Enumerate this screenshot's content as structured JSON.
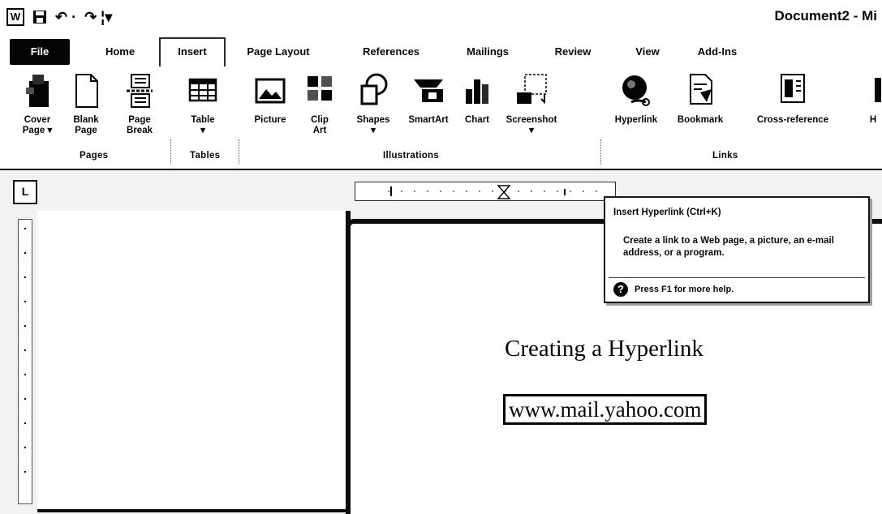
{
  "window": {
    "app_icon": "W",
    "title": "Document2 - Mi",
    "qat": {
      "save_icon": "save-icon",
      "undo_symbol": "↶ ·",
      "redo_symbol": "↷ ¦▾"
    }
  },
  "tabs": [
    {
      "label": "File"
    },
    {
      "label": "Home"
    },
    {
      "label": "Insert",
      "active": true
    },
    {
      "label": "Page Layout"
    },
    {
      "label": "References"
    },
    {
      "label": "Mailings"
    },
    {
      "label": "Review"
    },
    {
      "label": "View"
    },
    {
      "label": "Add-Ins"
    }
  ],
  "ribbon": {
    "pages": {
      "group_label": "Pages",
      "cover_page": "Cover Page ▾",
      "blank_page": "Blank Page",
      "page_break": "Page Break"
    },
    "tables": {
      "group_label": "Tables",
      "table": "Table",
      "table_arrow": "▾"
    },
    "illustrations": {
      "group_label": "Illustrations",
      "picture": "Picture",
      "clip_art": "Clip Art",
      "shapes": "Shapes",
      "shapes_arrow": "▾",
      "smartart": "SmartArt",
      "chart": "Chart",
      "screenshot": "Screenshot",
      "screenshot_arrow": "▾"
    },
    "links": {
      "group_label": "Links",
      "hyperlink": "Hyperlink",
      "bookmark": "Bookmark",
      "cross_reference": "Cross-reference",
      "overflow": "H"
    }
  },
  "tooltip": {
    "title": "Insert Hyperlink (Ctrl+K)",
    "body": "Create a link to a Web page, a picture, an e-mail address, or a program.",
    "help": "Press F1 for more help.",
    "help_icon": "?"
  },
  "document": {
    "heading": "Creating a Hyperlink",
    "link_text": "www.mail.yahoo.com"
  }
}
